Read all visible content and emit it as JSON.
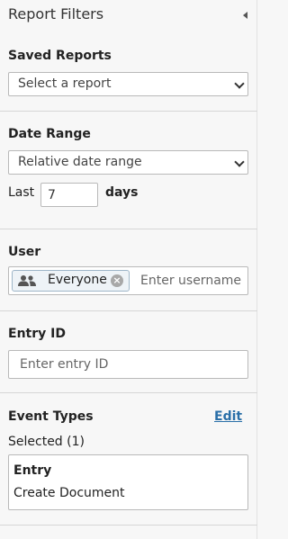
{
  "header": {
    "title": "Report Filters"
  },
  "saved_reports": {
    "label": "Saved Reports",
    "selected": "Select a report"
  },
  "date_range": {
    "label": "Date Range",
    "selected": "Relative date range",
    "last_label": "Last",
    "days_value": "7",
    "days_label": "days"
  },
  "user": {
    "label": "User",
    "chip_label": "Everyone",
    "placeholder": "Enter username"
  },
  "entry_id": {
    "label": "Entry ID",
    "placeholder": "Enter entry ID"
  },
  "event_types": {
    "label": "Event Types",
    "edit_label": "Edit",
    "selected_count": "Selected (1)",
    "category": "Entry",
    "item": "Create Document"
  },
  "colors": {
    "link": "#2a6fa8",
    "panel_bg": "#f7f7f7",
    "chip_bg": "#eef3f7"
  }
}
